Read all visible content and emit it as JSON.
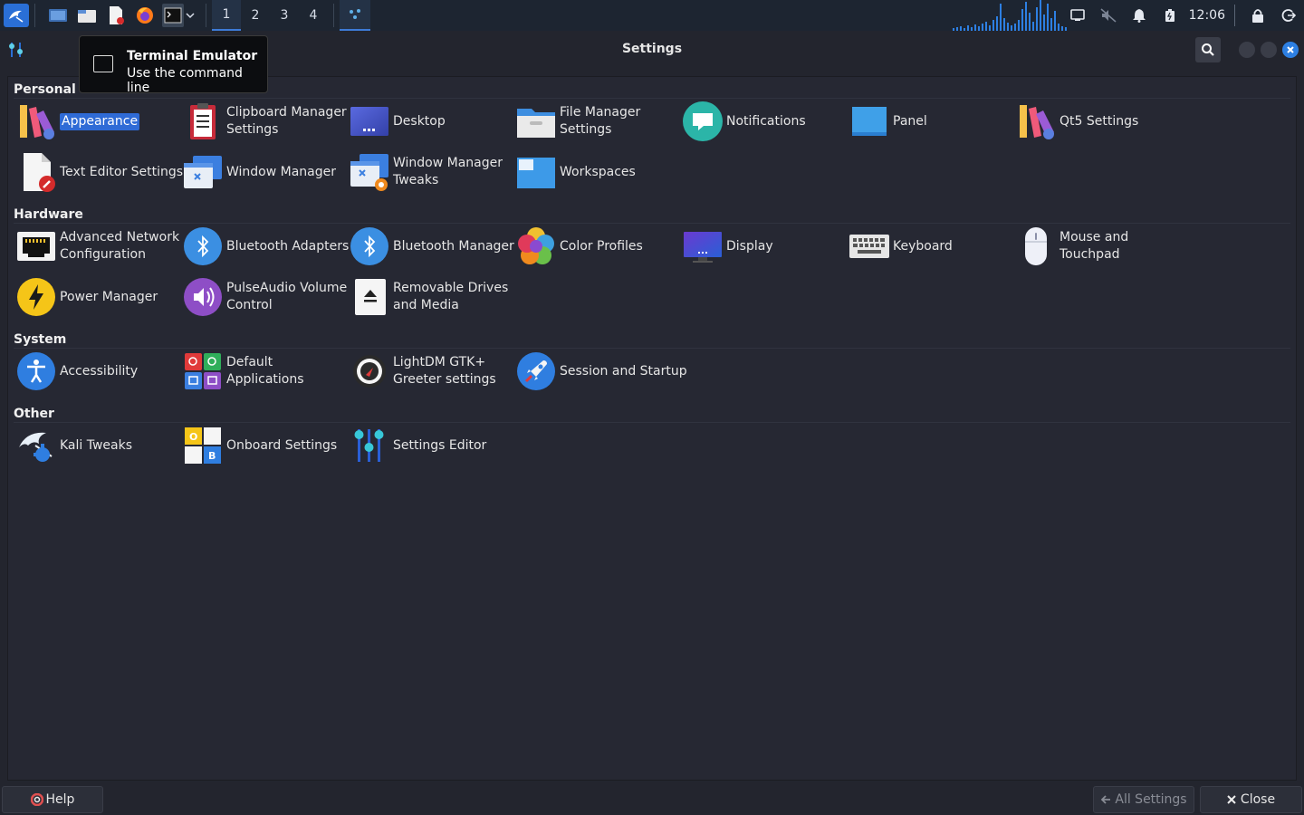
{
  "taskbar": {
    "workspaces": [
      "1",
      "2",
      "3",
      "4"
    ],
    "clock": "12:06"
  },
  "tooltip": {
    "title": "Terminal Emulator",
    "subtitle": "Use the command line"
  },
  "window": {
    "title": "Settings"
  },
  "sections": {
    "personal": "Personal",
    "hardware": "Hardware",
    "system": "System",
    "other": "Other"
  },
  "items": {
    "appearance": "Appearance",
    "clipboard": "Clipboard Manager\nSettings",
    "desktop": "Desktop",
    "file_manager": "File Manager\nSettings",
    "notifications": "Notifications",
    "panel": "Panel",
    "qt5": "Qt5 Settings",
    "text_editor": "Text Editor Settings",
    "window_manager": "Window Manager",
    "wm_tweaks": "Window Manager\nTweaks",
    "workspaces": "Workspaces",
    "adv_network": "Advanced Network\nConfiguration",
    "bt_adapters": "Bluetooth Adapters",
    "bt_manager": "Bluetooth Manager",
    "color_profiles": "Color Profiles",
    "display": "Display",
    "keyboard": "Keyboard",
    "mouse": "Mouse and\nTouchpad",
    "power": "Power Manager",
    "pulseaudio": "PulseAudio Volume\nControl",
    "removable": "Removable Drives\nand Media",
    "accessibility": "Accessibility",
    "default_apps": "Default\nApplications",
    "lightdm": "LightDM GTK+\nGreeter settings",
    "session": "Session and Startup",
    "kali_tweaks": "Kali Tweaks",
    "onboard": "Onboard Settings",
    "settings_editor": "Settings Editor"
  },
  "bottom": {
    "help": "Help",
    "all_settings": "All Settings",
    "close": "Close"
  },
  "colors": {
    "accent": "#2f6bd6",
    "taskbar": "#1d2531",
    "background": "#262833"
  }
}
